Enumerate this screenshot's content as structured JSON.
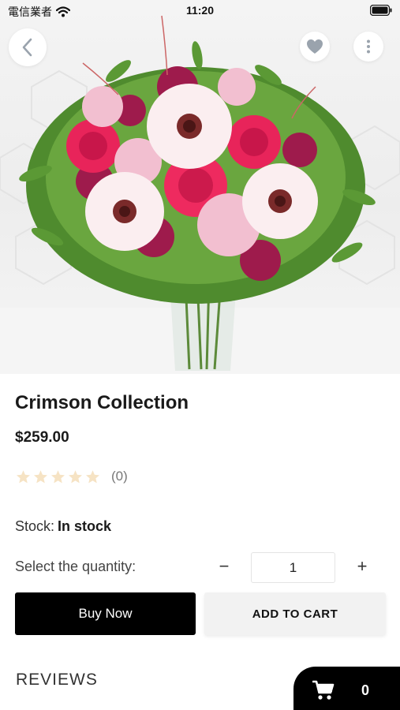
{
  "status_bar": {
    "carrier": "電信業者",
    "time": "11:20"
  },
  "product": {
    "title": "Crimson Collection",
    "price": "$259.00",
    "rating": {
      "stars": 0,
      "max": 5,
      "count_label": "(0)"
    },
    "stock_label": "Stock:",
    "stock_value": "In stock"
  },
  "quantity": {
    "label": "Select the quantity:",
    "minus": "−",
    "value": "1",
    "plus": "+"
  },
  "actions": {
    "buy_now": "Buy Now",
    "add_to_cart": "ADD TO CART"
  },
  "reviews": {
    "heading": "REVIEWS"
  },
  "cart": {
    "count": "0"
  },
  "icons": {
    "back": "chevron-left-icon",
    "favorite": "heart-icon",
    "more": "vertical-dots-icon",
    "cart": "cart-icon",
    "star": "star-icon"
  },
  "colors": {
    "primary_button": "#000000",
    "secondary_button": "#f2f2f2",
    "star_empty": "#f6e3c4",
    "icon_gray": "#9aa3ad"
  }
}
